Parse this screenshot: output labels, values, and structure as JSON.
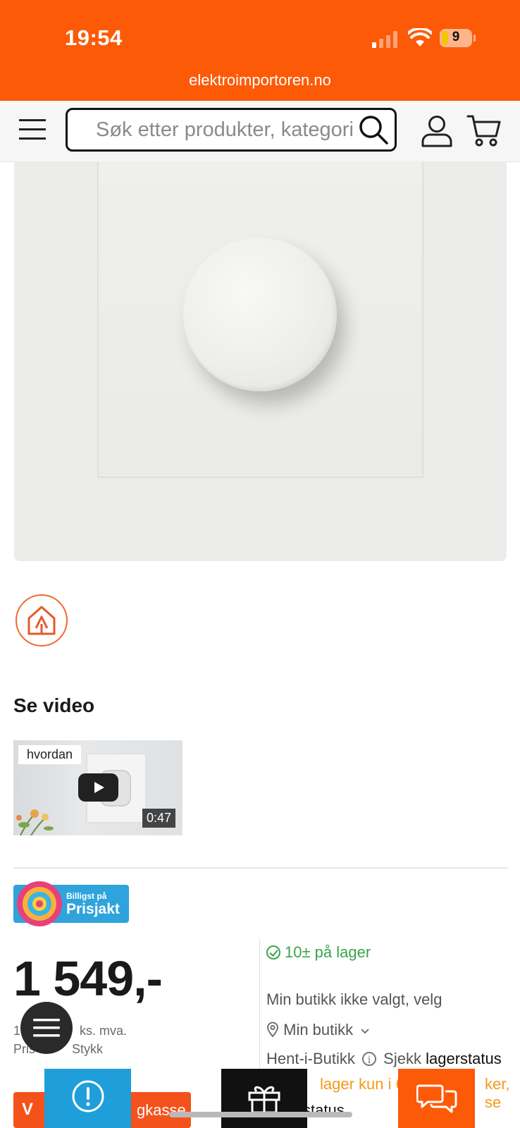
{
  "status_bar": {
    "time": "19:54",
    "battery": "9",
    "url": "elektroimportoren.no"
  },
  "header": {
    "search_placeholder": "Søk etter produkter, kategori"
  },
  "video": {
    "heading": "Se video",
    "label": "hvordan",
    "duration": "0:47"
  },
  "prisjakt": {
    "small": "Billigst på",
    "big": "Prisjakt"
  },
  "price": {
    "amount": "1 549,-",
    "vat_partial": "ks. mva.",
    "unit_partial": "Stykk",
    "vat_leading": "1",
    "unit_leading": "Pris"
  },
  "stock": {
    "in_stock": "10± på lager",
    "store_not_selected": "Min butikk ikke valgt, velg",
    "my_store": "Min butikk",
    "pickup_label": "Hent-i-Butikk",
    "check": "Sjekk",
    "check_link": "lagerstatus",
    "on_stock_partial": "lager kun i 6",
    "on_stock_tail": "ker, se",
    "status_partial": "status"
  },
  "cart_button": {
    "label_left": "V",
    "label_right": "gkasse"
  },
  "colors": {
    "brand": "#fd5a08",
    "stock_green": "#3aa44a",
    "stock_orange": "#f39a1a",
    "prisjakt_blue": "#2ea3dc"
  }
}
